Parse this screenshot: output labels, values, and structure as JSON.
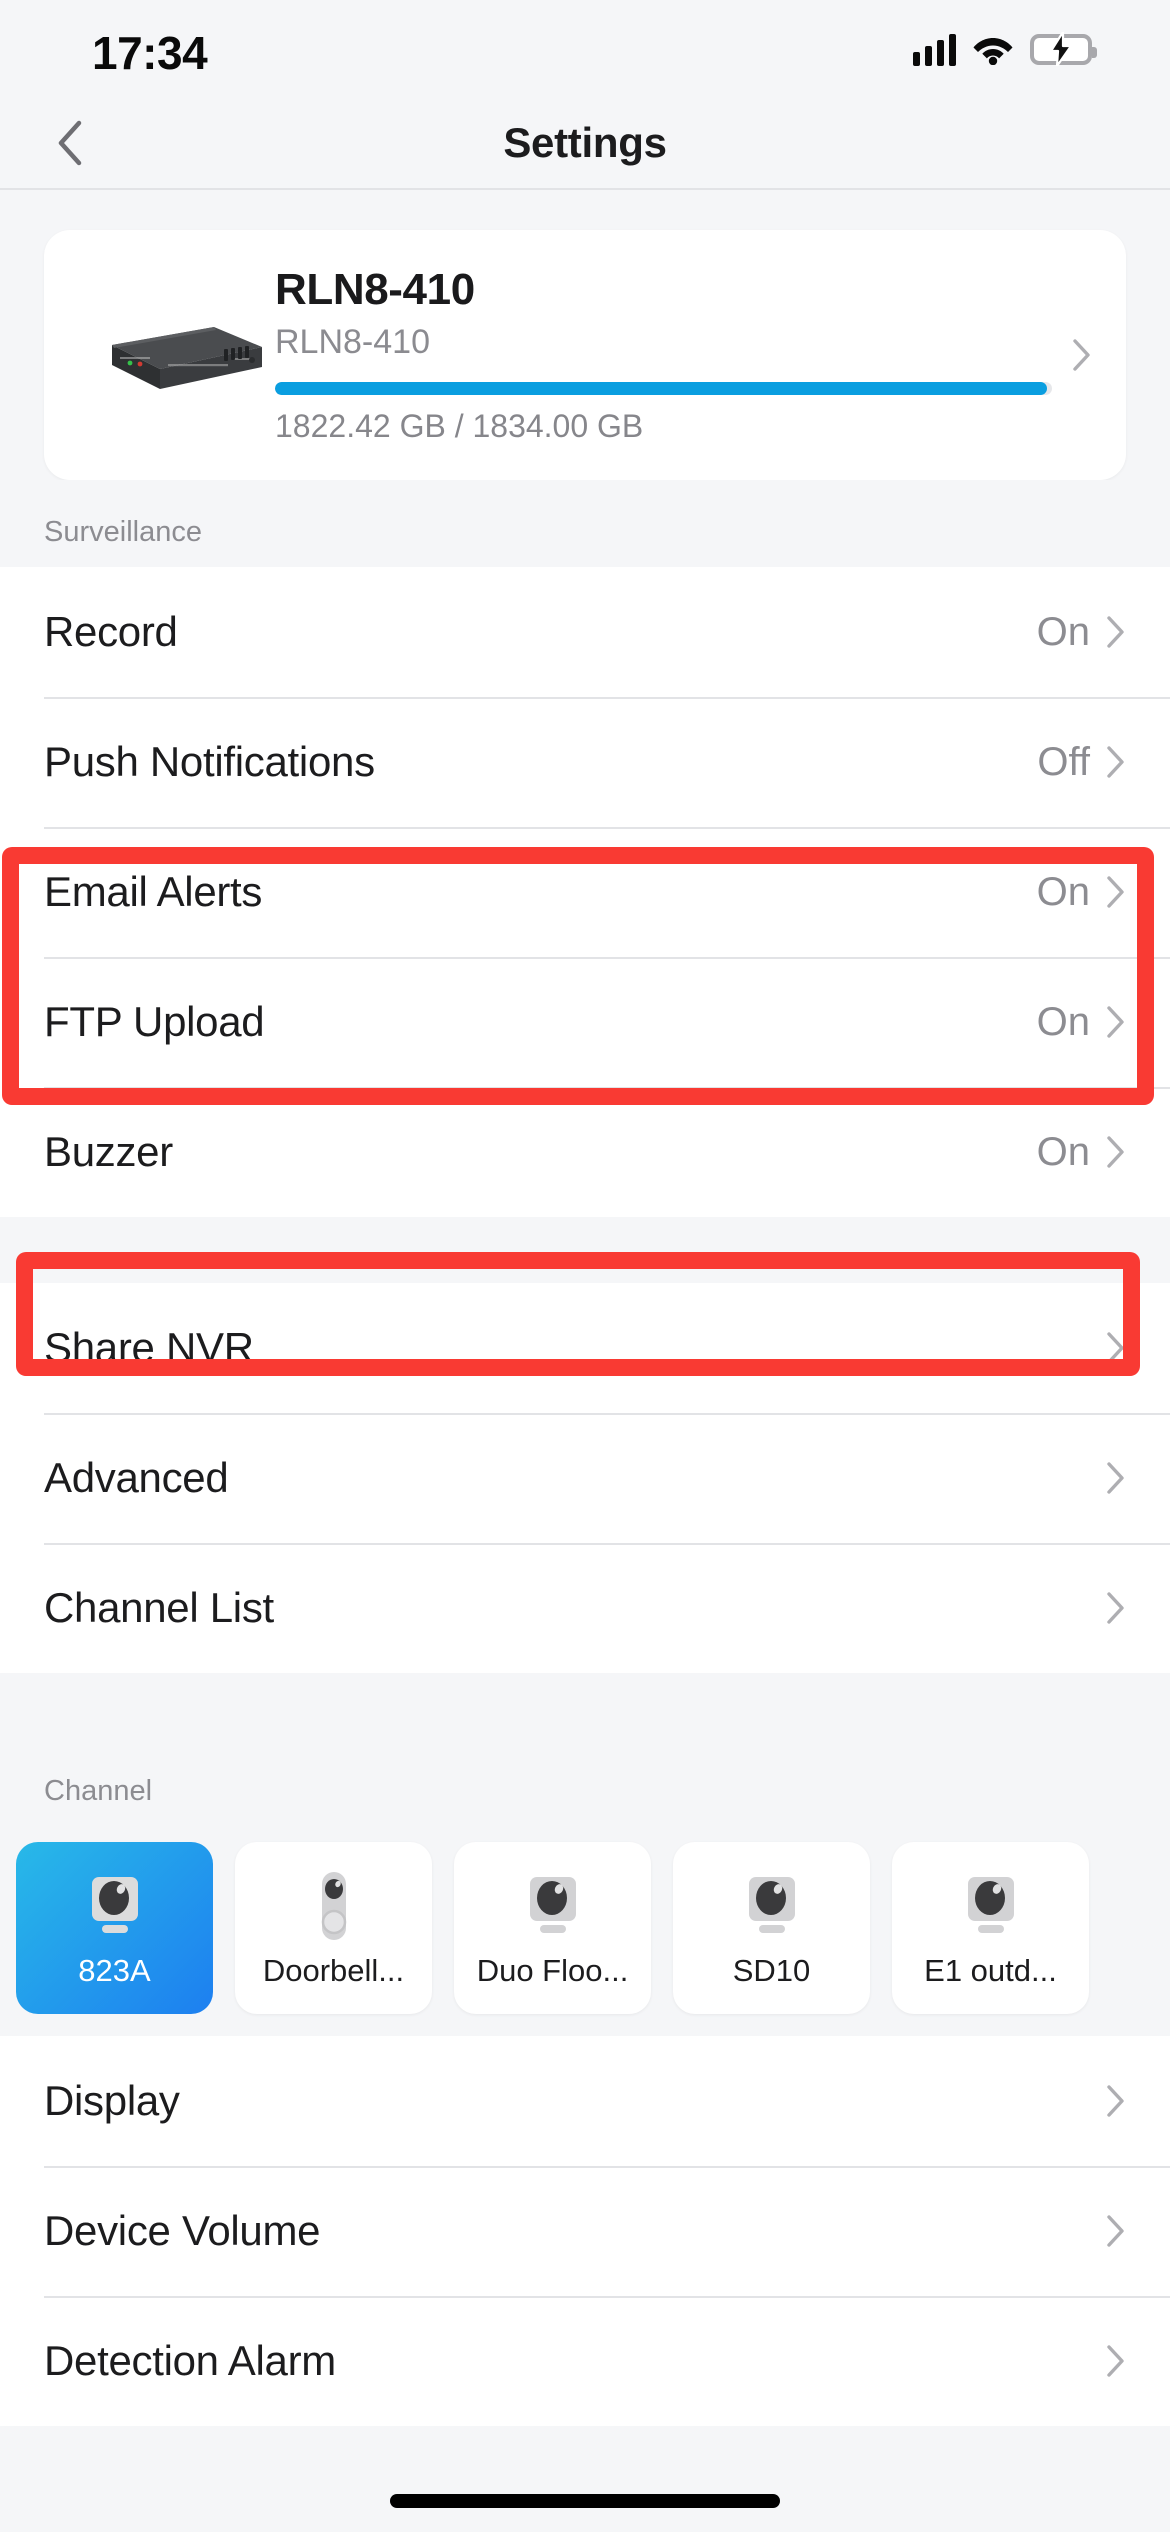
{
  "status_bar": {
    "time": "17:34",
    "signal_icon": "cellular-signal-icon",
    "wifi_icon": "wifi-icon",
    "battery_icon": "battery-charging-icon",
    "battery_level_pct": 100,
    "battery_color": "#33d158"
  },
  "nav": {
    "back_icon": "chevron-left-icon",
    "title": "Settings"
  },
  "device_card": {
    "thumb_icon": "nvr-device-icon",
    "name": "RLN8-410",
    "model": "RLN8-410",
    "storage_text": "1822.42 GB / 1834.00 GB",
    "storage_used_gb": 1822.42,
    "storage_total_gb": 1834.0,
    "storage_pct": 99.4,
    "progress_color": "#0a9ee0",
    "chevron_icon": "chevron-right-icon"
  },
  "surveillance": {
    "header": "Surveillance",
    "rows": [
      {
        "label": "Record",
        "value": "On",
        "chevron_icon": "chevron-right-icon"
      },
      {
        "label": "Push Notifications",
        "value": "Off",
        "chevron_icon": "chevron-right-icon"
      },
      {
        "label": "Email Alerts",
        "value": "On",
        "chevron_icon": "chevron-right-icon"
      },
      {
        "label": "FTP Upload",
        "value": "On",
        "chevron_icon": "chevron-right-icon"
      },
      {
        "label": "Buzzer",
        "value": "On",
        "chevron_icon": "chevron-right-icon"
      }
    ]
  },
  "management": {
    "rows": [
      {
        "label": "Share NVR",
        "value": "",
        "chevron_icon": "chevron-right-icon"
      },
      {
        "label": "Advanced",
        "value": "",
        "chevron_icon": "chevron-right-icon"
      },
      {
        "label": "Channel List",
        "value": "",
        "chevron_icon": "chevron-right-icon"
      }
    ]
  },
  "channel": {
    "header": "Channel",
    "chips": [
      {
        "label": "823A",
        "icon": "camera-icon",
        "selected": true
      },
      {
        "label": "Doorbell...",
        "icon": "doorbell-icon",
        "selected": false
      },
      {
        "label": "Duo Floo...",
        "icon": "camera-icon",
        "selected": false
      },
      {
        "label": "SD10",
        "icon": "camera-icon",
        "selected": false
      },
      {
        "label": "E1 outd...",
        "icon": "camera-icon",
        "selected": false
      }
    ],
    "rows": [
      {
        "label": "Display",
        "value": "",
        "chevron_icon": "chevron-right-icon"
      },
      {
        "label": "Device Volume",
        "value": "",
        "chevron_icon": "chevron-right-icon"
      },
      {
        "label": "Detection Alarm",
        "value": "",
        "chevron_icon": "chevron-right-icon"
      }
    ]
  },
  "annotations": {
    "highlight_color": "#f93a33",
    "boxes": [
      {
        "name": "push-notifications-and-email-alerts"
      },
      {
        "name": "buzzer"
      }
    ]
  }
}
